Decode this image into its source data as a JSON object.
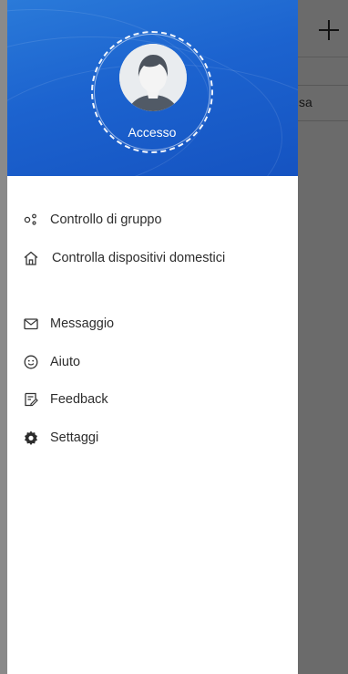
{
  "background": {
    "partial_text": "sa"
  },
  "drawer": {
    "login_label": "Accesso",
    "menu": [
      {
        "label": "Controllo di gruppo",
        "icon": "group-control-icon"
      },
      {
        "label": "Controlla dispositivi domestici",
        "icon": "home-icon"
      },
      {
        "label": "Messaggio",
        "icon": "mail-icon"
      },
      {
        "label": "Aiuto",
        "icon": "smiley-icon"
      },
      {
        "label": "Feedback",
        "icon": "feedback-icon"
      },
      {
        "label": "Settaggi",
        "icon": "gear-icon"
      }
    ]
  },
  "colors": {
    "header_blue": "#1c63cf",
    "text": "#2d2d2d"
  }
}
